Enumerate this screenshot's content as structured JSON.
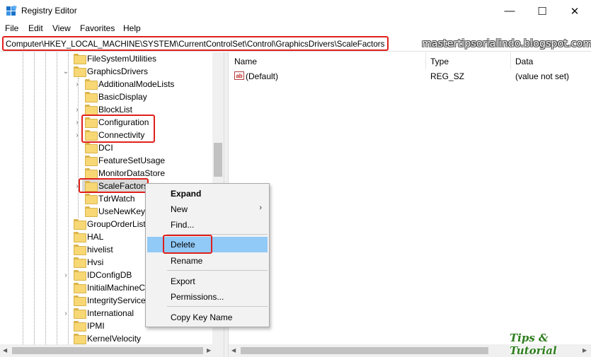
{
  "window": {
    "title": "Registry Editor",
    "minimize_glyph": "—",
    "maximize_glyph": "☐",
    "close_glyph": "✕"
  },
  "menu": [
    "File",
    "Edit",
    "View",
    "Favorites",
    "Help"
  ],
  "address": "Computer\\HKEY_LOCAL_MACHINE\\SYSTEM\\CurrentControlSet\\Control\\GraphicsDrivers\\ScaleFactors",
  "watermark": "mastertipsorialindo.blogspot.com",
  "tree": {
    "items": [
      {
        "label": "FileSystemUtilities",
        "chevron": ""
      },
      {
        "label": "GraphicsDrivers",
        "chevron": "⌄"
      },
      {
        "label": "AdditionalModeLists",
        "chevron": "›"
      },
      {
        "label": "BasicDisplay",
        "chevron": ""
      },
      {
        "label": "BlockList",
        "chevron": "›"
      },
      {
        "label": "Configuration",
        "chevron": "›"
      },
      {
        "label": "Connectivity",
        "chevron": "›"
      },
      {
        "label": "DCI",
        "chevron": ""
      },
      {
        "label": "FeatureSetUsage",
        "chevron": ""
      },
      {
        "label": "MonitorDataStore",
        "chevron": ""
      },
      {
        "label": "ScaleFactors",
        "chevron": "›"
      },
      {
        "label": "TdrWatch",
        "chevron": ""
      },
      {
        "label": "UseNewKey",
        "chevron": ""
      },
      {
        "label": "GroupOrderList",
        "chevron": ""
      },
      {
        "label": "HAL",
        "chevron": ""
      },
      {
        "label": "hivelist",
        "chevron": ""
      },
      {
        "label": "Hvsi",
        "chevron": ""
      },
      {
        "label": "IDConfigDB",
        "chevron": "›"
      },
      {
        "label": "InitialMachineC",
        "chevron": ""
      },
      {
        "label": "IntegrityService",
        "chevron": ""
      },
      {
        "label": "International",
        "chevron": "›"
      },
      {
        "label": "IPMI",
        "chevron": ""
      },
      {
        "label": "KernelVelocity",
        "chevron": ""
      }
    ]
  },
  "list": {
    "headers": {
      "name": "Name",
      "type": "Type",
      "data": "Data"
    },
    "rows": [
      {
        "icon": "ab",
        "name": "(Default)",
        "type": "REG_SZ",
        "data": "(value not set)"
      }
    ]
  },
  "context_menu": {
    "expand": "Expand",
    "new": "New",
    "new_arrow": "›",
    "find": "Find...",
    "delete": "Delete",
    "rename": "Rename",
    "export": "Export",
    "permissions": "Permissions...",
    "copy_key_name": "Copy Key Name"
  },
  "logo": "Tips & Tutorial",
  "colors": {
    "highlight_red": "#e0201b",
    "menu_hover": "#91c9f7",
    "folder_yellow": "#f8d775",
    "logo_green": "#2e7d1e"
  }
}
